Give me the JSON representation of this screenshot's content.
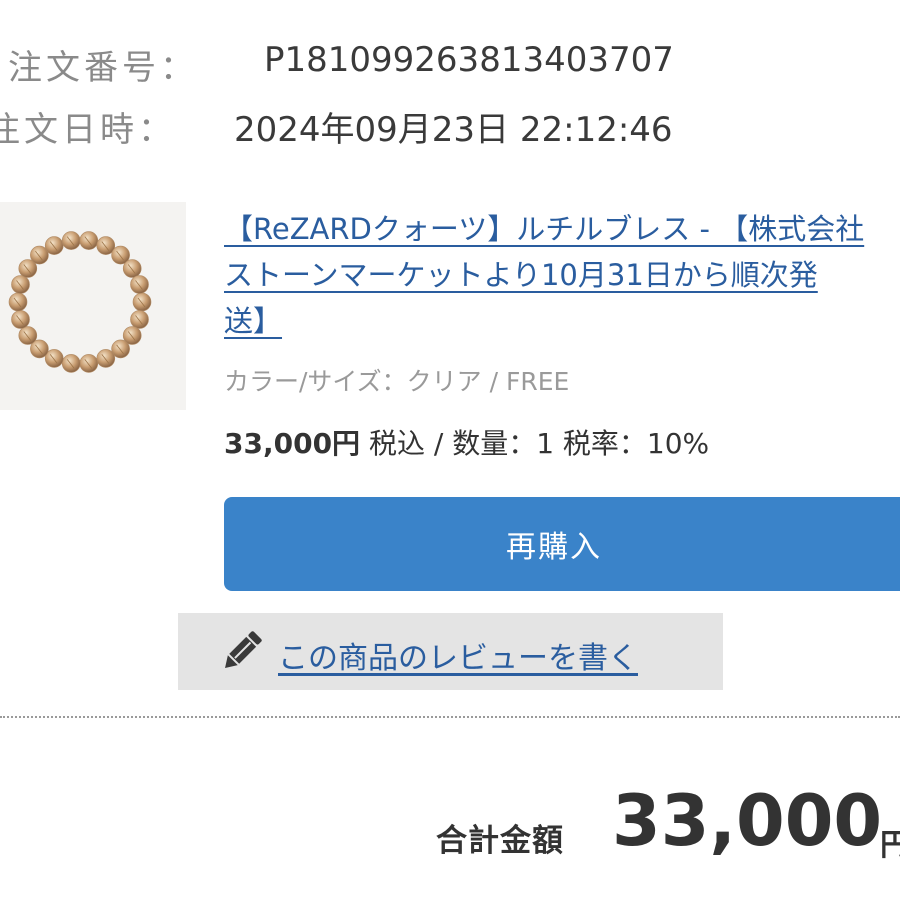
{
  "order": {
    "number_label": "注文番号：",
    "number_value": "P181099263813403707",
    "date_label": "注文日時：",
    "date_value": "2024年09月23日 22:12:46"
  },
  "product": {
    "image_icon": "rutile-bracelet-thumbnail",
    "title_line1": "【ReZARDクォーツ】ルチルブレス - 【株式会社",
    "title_line2": "ストーンマーケットより10月31日から順次発",
    "title_line3": "送】",
    "variant": "カラー/サイズ：クリア / FREE",
    "price": "33,000円",
    "price_details": " 税込 / 数量：1 税率：10%"
  },
  "actions": {
    "rebuy_label": "再購入",
    "review_icon": "pencil-icon",
    "review_label": "この商品のレビューを書く"
  },
  "total": {
    "label": "合計金額",
    "value": "33,000",
    "unit": "円"
  },
  "colors": {
    "link": "#2a5d9f",
    "button": "#3a83c9",
    "review_bg": "#e4e4e4"
  }
}
